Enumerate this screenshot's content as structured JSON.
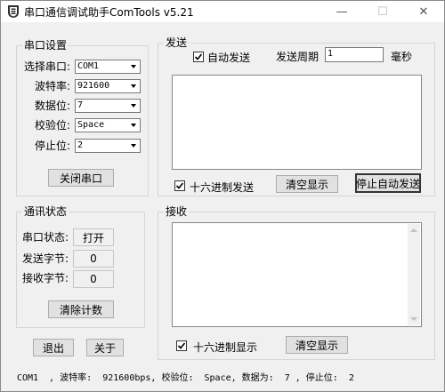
{
  "window": {
    "title": "串口通信调试助手ComTools v5.21",
    "minimize": "—",
    "maximize": "☐",
    "close": "✕"
  },
  "serial_settings": {
    "group_title": "串口设置",
    "port_label": "选择串口:",
    "port_value": "COM1",
    "baud_label": "波特率:",
    "baud_value": "921600",
    "databits_label": "数据位:",
    "databits_value": "7",
    "parity_label": "校验位:",
    "parity_value": "Space",
    "stopbits_label": "停止位:",
    "stopbits_value": "2",
    "close_port_button": "关闭串口"
  },
  "comm_status": {
    "group_title": "通讯状态",
    "port_status_label": "串口状态:",
    "port_status_value": "打开",
    "sent_bytes_label": "发送字节:",
    "sent_bytes_value": "0",
    "recv_bytes_label": "接收字节:",
    "recv_bytes_value": "0",
    "clear_count_button": "清除计数"
  },
  "bottom_buttons": {
    "exit": "退出",
    "about": "关于"
  },
  "send": {
    "group_title": "发送",
    "auto_send_label": "自动发送",
    "auto_send_checked": true,
    "period_label": "发送周期",
    "period_value": "1",
    "period_unit": "毫秒",
    "hex_send_label": "十六进制发送",
    "hex_send_checked": true,
    "clear_button": "清空显示",
    "stop_auto_button": "停止自动发送"
  },
  "receive": {
    "group_title": "接收",
    "hex_display_label": "十六进制显示",
    "hex_display_checked": true,
    "clear_button": "清空显示"
  },
  "status_bar": {
    "text": "COM1  , 波特率:  921600bps, 校验位:  Space, 数据为:  7 , 停止位:  2"
  }
}
